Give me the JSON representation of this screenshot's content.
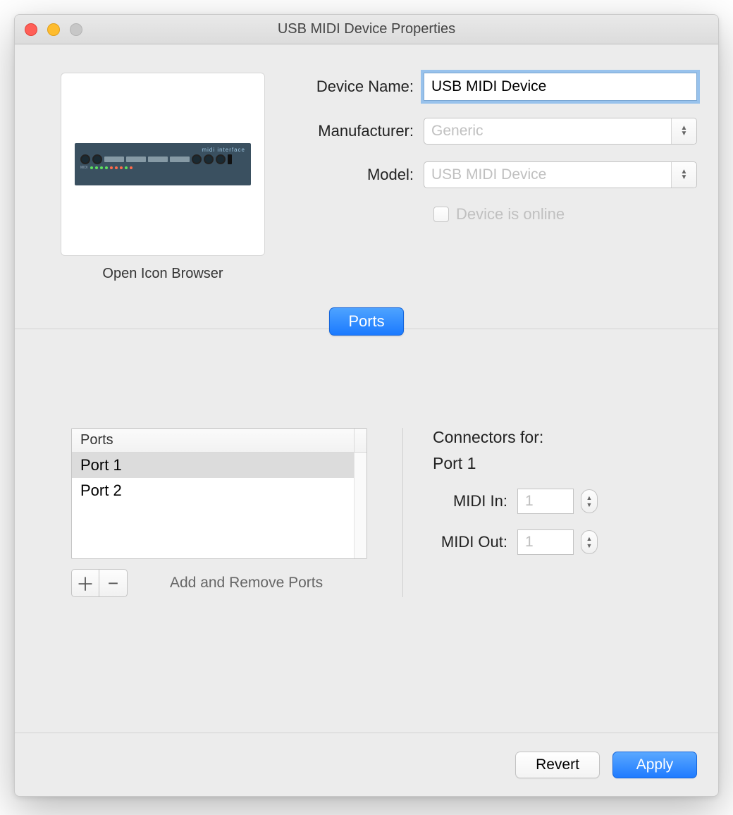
{
  "window": {
    "title": "USB MIDI Device Properties"
  },
  "icon": {
    "caption": "Open Icon Browser",
    "badge": "midi interface"
  },
  "fields": {
    "device_name_label": "Device Name:",
    "device_name_value": "USB MIDI Device",
    "manufacturer_label": "Manufacturer:",
    "manufacturer_value": "Generic",
    "model_label": "Model:",
    "model_value": "USB MIDI Device",
    "online_label": "Device is online",
    "online_checked": false
  },
  "tabs": {
    "ports": "Ports"
  },
  "ports": {
    "header": "Ports",
    "items": [
      "Port 1",
      "Port 2"
    ],
    "selected_index": 0,
    "hint": "Add and Remove Ports"
  },
  "connectors": {
    "title": "Connectors for:",
    "selected_port": "Port 1",
    "midi_in_label": "MIDI In:",
    "midi_in_value": "1",
    "midi_out_label": "MIDI Out:",
    "midi_out_value": "1"
  },
  "footer": {
    "revert": "Revert",
    "apply": "Apply"
  }
}
